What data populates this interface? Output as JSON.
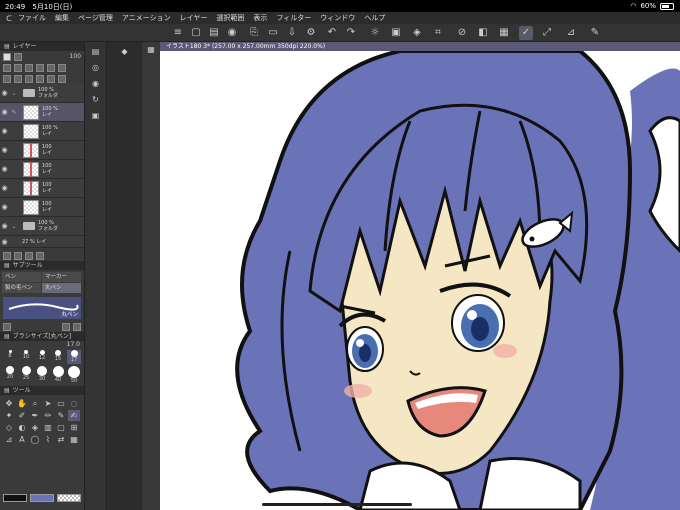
{
  "status": {
    "time": "20:49",
    "date": "5月10日(日)",
    "battery": "60%",
    "battery_level": 0.6
  },
  "menu": [
    "ファイル",
    "編集",
    "ページ管理",
    "アニメーション",
    "レイヤー",
    "選択範囲",
    "表示",
    "フィルター",
    "ウィンドウ",
    "ヘルプ"
  ],
  "canvas_tab": "イラスト180 3* (257.00 x 257.00mm 350dpi 220.0%)",
  "layer_panel": {
    "title": "レイヤー",
    "opacity_value": "100",
    "layers": [
      {
        "opacity": "100 %",
        "name": "フォルダ",
        "type": "folder"
      },
      {
        "opacity": "100 %",
        "name": "レイ",
        "type": "raster",
        "selected": true
      },
      {
        "opacity": "100 %",
        "name": "レイ",
        "type": "raster"
      },
      {
        "opacity": "100",
        "name": "レイ",
        "type": "raster",
        "mask": true
      },
      {
        "opacity": "100",
        "name": "レイ",
        "type": "raster",
        "mask": true
      },
      {
        "opacity": "100",
        "name": "レイ",
        "type": "raster",
        "mask": true
      },
      {
        "opacity": "100",
        "name": "レイ",
        "type": "raster"
      },
      {
        "opacity": "100 %",
        "name": "フォルダ",
        "type": "folder"
      },
      {
        "opacity": "27 %",
        "name": "レイ",
        "type": "raster"
      }
    ]
  },
  "subtool_panel": {
    "title": "サブツール",
    "tabs": [
      {
        "label": "ペン",
        "active": false
      },
      {
        "label": "マーカー",
        "active": false
      },
      {
        "label": "製の毛ペン",
        "active": false
      },
      {
        "label": "丸ペン",
        "active": true
      }
    ],
    "brush_name": "丸ペン"
  },
  "brush_size_panel": {
    "title": "ブラシサイズ[丸ペン]",
    "value": "17.0",
    "sizes": [
      "8",
      "10",
      "12",
      "15",
      "17",
      "20",
      "25",
      "30",
      "40",
      "50"
    ],
    "selected": "17"
  },
  "tool_panel": {
    "title": "ツール"
  },
  "colors": {
    "main": "#6a73b8",
    "sub": "#ffffff",
    "hair": "#6a73b8",
    "skin": "#f5e6c4",
    "line": "#111111"
  }
}
